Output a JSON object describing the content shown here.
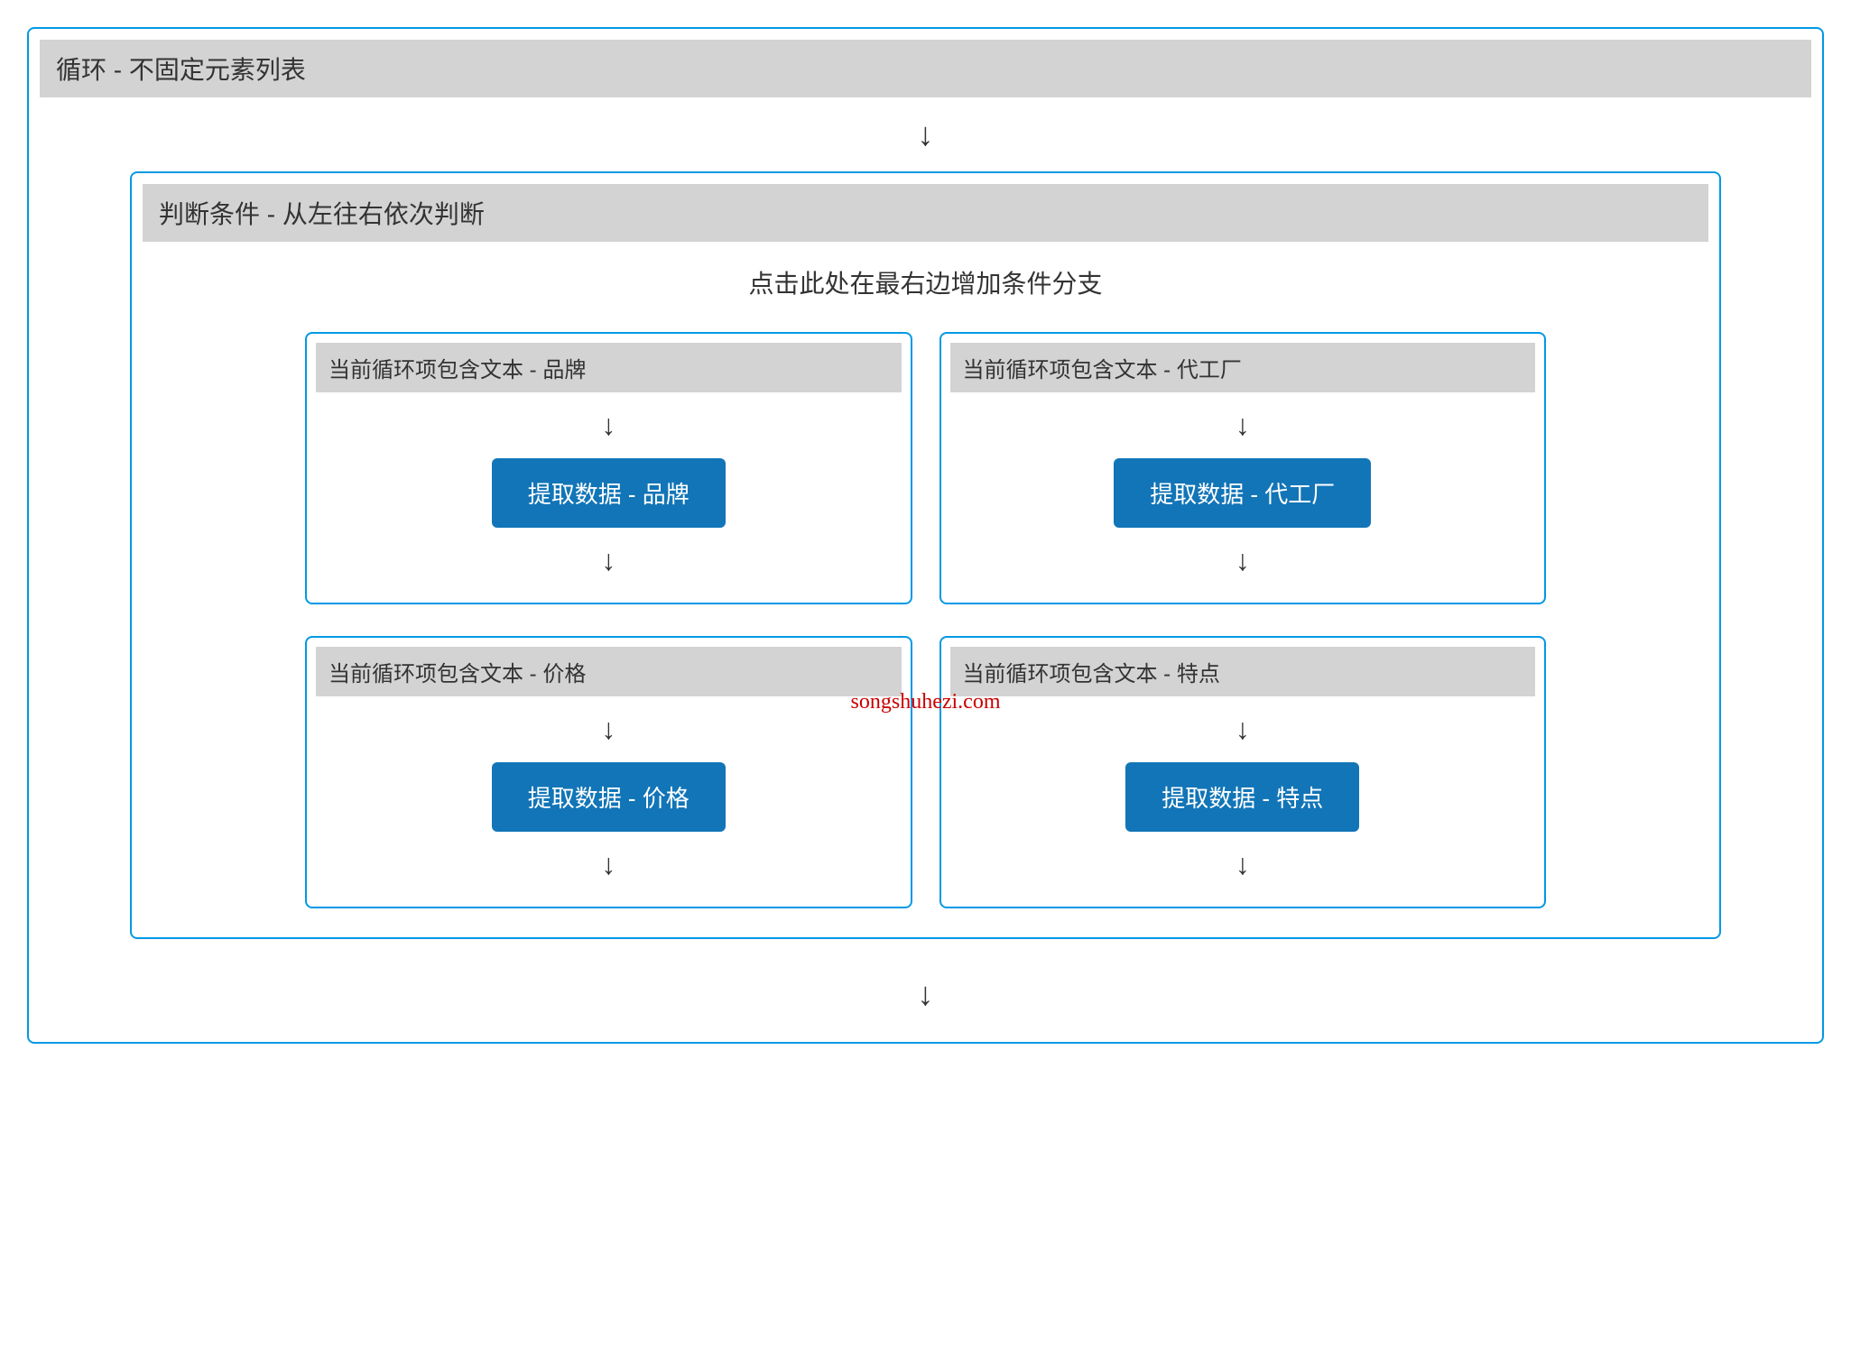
{
  "outer": {
    "title": "循环 - 不固定元素列表"
  },
  "inner": {
    "title": "判断条件 - 从左往右依次判断",
    "instruction": "点击此处在最右边增加条件分支"
  },
  "branches": [
    {
      "header": "当前循环项包含文本 - 品牌",
      "action": "提取数据 - 品牌"
    },
    {
      "header": "当前循环项包含文本 - 代工厂",
      "action": "提取数据 - 代工厂"
    },
    {
      "header": "当前循环项包含文本 - 价格",
      "action": "提取数据 - 价格"
    },
    {
      "header": "当前循环项包含文本 - 特点",
      "action": "提取数据 - 特点"
    }
  ],
  "arrow": "↓",
  "watermark": "songshuhezi.com"
}
